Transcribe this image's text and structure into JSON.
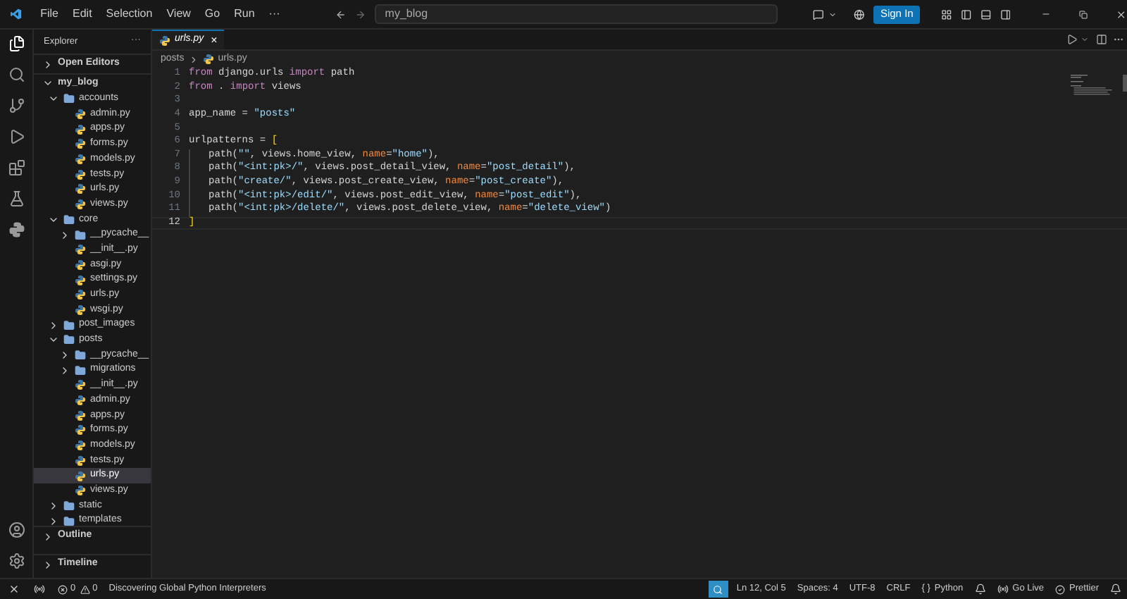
{
  "menu": [
    "File",
    "Edit",
    "Selection",
    "View",
    "Go",
    "Run",
    "···"
  ],
  "command_center": {
    "value": "my_blog"
  },
  "sign_in": "Sign In",
  "explorer": {
    "title": "Explorer",
    "more": "···",
    "sections": [
      {
        "label": "Open Editors",
        "expanded": false
      }
    ]
  },
  "tree": {
    "label": "my_blog",
    "expanded": true,
    "children": [
      {
        "label": "accounts",
        "kind": "folder",
        "expanded": true,
        "children": [
          {
            "label": "admin.py",
            "kind": "python",
            "selected": false
          },
          {
            "label": "apps.py",
            "kind": "python",
            "selected": false
          },
          {
            "label": "forms.py",
            "kind": "python",
            "selected": false
          },
          {
            "label": "models.py",
            "kind": "python",
            "selected": false
          },
          {
            "label": "tests.py",
            "kind": "python",
            "selected": false
          },
          {
            "label": "urls.py",
            "kind": "python",
            "selected": false
          },
          {
            "label": "views.py",
            "kind": "python",
            "selected": false
          }
        ]
      },
      {
        "label": "core",
        "kind": "folder",
        "expanded": true,
        "children": [
          {
            "label": "__pycache__",
            "kind": "folder",
            "expanded": false
          },
          {
            "label": "__init__.py",
            "kind": "python",
            "selected": false
          },
          {
            "label": "asgi.py",
            "kind": "python",
            "selected": false
          },
          {
            "label": "settings.py",
            "kind": "python",
            "selected": false
          },
          {
            "label": "urls.py",
            "kind": "python",
            "selected": false
          },
          {
            "label": "wsgi.py",
            "kind": "python",
            "selected": false
          }
        ]
      },
      {
        "label": "post_images",
        "kind": "folder",
        "expanded": false
      },
      {
        "label": "posts",
        "kind": "folder",
        "expanded": true,
        "children": [
          {
            "label": "__pycache__",
            "kind": "folder",
            "expanded": false
          },
          {
            "label": "migrations",
            "kind": "folder",
            "expanded": false
          },
          {
            "label": "__init__.py",
            "kind": "python",
            "selected": false
          },
          {
            "label": "admin.py",
            "kind": "python",
            "selected": false
          },
          {
            "label": "apps.py",
            "kind": "python",
            "selected": false
          },
          {
            "label": "forms.py",
            "kind": "python",
            "selected": false
          },
          {
            "label": "models.py",
            "kind": "python",
            "selected": false
          },
          {
            "label": "tests.py",
            "kind": "python",
            "selected": false
          },
          {
            "label": "urls.py",
            "kind": "python",
            "selected": true
          },
          {
            "label": "views.py",
            "kind": "python",
            "selected": false
          }
        ]
      },
      {
        "label": "static",
        "kind": "folder",
        "expanded": false
      },
      {
        "label": "templates",
        "kind": "folder",
        "expanded": false
      }
    ]
  },
  "bottom_sections": [
    {
      "label": "Outline",
      "expanded": false
    },
    {
      "label": "Timeline",
      "expanded": false
    }
  ],
  "tab": {
    "label": "urls.py",
    "close": "×",
    "selected": true
  },
  "breadcrumb": [
    "posts",
    "urls.py"
  ],
  "code": {
    "lines": [
      {
        "number": "1",
        "indent": false,
        "tokens": [
          {
            "kind": "keyword",
            "text": "from"
          },
          {
            "kind": "plain",
            "text": " django.urls "
          },
          {
            "kind": "keyword",
            "text": "import"
          },
          {
            "kind": "plain",
            "text": " path"
          }
        ]
      },
      {
        "number": "2",
        "indent": false,
        "tokens": [
          {
            "kind": "keyword",
            "text": "from"
          },
          {
            "kind": "plain",
            "text": " . "
          },
          {
            "kind": "keyword",
            "text": "import"
          },
          {
            "kind": "plain",
            "text": " views"
          }
        ]
      },
      {
        "number": "3",
        "indent": false
      },
      {
        "number": "4",
        "indent": false,
        "tokens": [
          {
            "kind": "plain",
            "text": "app_name = "
          },
          {
            "kind": "string",
            "text": "\"posts\""
          }
        ]
      },
      {
        "number": "5",
        "indent": false
      },
      {
        "number": "6",
        "indent": false,
        "tokens": [
          {
            "kind": "plain",
            "text": "urlpatterns = "
          },
          {
            "kind": "bracket",
            "text": "["
          }
        ]
      },
      {
        "number": "7",
        "indent": true,
        "tokens": [
          {
            "kind": "plain",
            "text": "path("
          },
          {
            "kind": "string",
            "text": "\"\""
          },
          {
            "kind": "plain",
            "text": ", views.home_view, "
          },
          {
            "kind": "param",
            "text": "name"
          },
          {
            "kind": "plain",
            "text": "="
          },
          {
            "kind": "string",
            "text": "\"home\""
          },
          {
            "kind": "plain",
            "text": "),"
          }
        ]
      },
      {
        "number": "8",
        "indent": true,
        "tokens": [
          {
            "kind": "plain",
            "text": "path("
          },
          {
            "kind": "string",
            "text": "\"<int:pk>/\""
          },
          {
            "kind": "plain",
            "text": ", views.post_detail_view, "
          },
          {
            "kind": "param",
            "text": "name"
          },
          {
            "kind": "plain",
            "text": "="
          },
          {
            "kind": "string",
            "text": "\"post_detail\""
          },
          {
            "kind": "plain",
            "text": "),"
          }
        ]
      },
      {
        "number": "9",
        "indent": true,
        "tokens": [
          {
            "kind": "plain",
            "text": "path("
          },
          {
            "kind": "string",
            "text": "\"create/\""
          },
          {
            "kind": "plain",
            "text": ", views.post_create_view, "
          },
          {
            "kind": "param",
            "text": "name"
          },
          {
            "kind": "plain",
            "text": "="
          },
          {
            "kind": "string",
            "text": "\"post_create\""
          },
          {
            "kind": "plain",
            "text": "),"
          }
        ]
      },
      {
        "number": "10",
        "indent": true,
        "tokens": [
          {
            "kind": "plain",
            "text": "path("
          },
          {
            "kind": "string",
            "text": "\"<int:pk>/edit/\""
          },
          {
            "kind": "plain",
            "text": ", views.post_edit_view, "
          },
          {
            "kind": "param",
            "text": "name"
          },
          {
            "kind": "plain",
            "text": "="
          },
          {
            "kind": "string",
            "text": "\"post_edit\""
          },
          {
            "kind": "plain",
            "text": "),"
          }
        ]
      },
      {
        "number": "11",
        "indent": true,
        "tokens": [
          {
            "kind": "plain",
            "text": "path("
          },
          {
            "kind": "string",
            "text": "\"<int:pk>/delete/\""
          },
          {
            "kind": "plain",
            "text": ", views.post_delete_view, "
          },
          {
            "kind": "param",
            "text": "name"
          },
          {
            "kind": "plain",
            "text": "="
          },
          {
            "kind": "string",
            "text": "\"delete_view\""
          },
          {
            "kind": "plain",
            "text": ")"
          }
        ]
      },
      {
        "number": "12",
        "indent": false,
        "current": true,
        "tokens": [
          {
            "kind": "bracket",
            "text": "]"
          }
        ]
      }
    ]
  },
  "status_bar": {
    "errors": "0",
    "warnings": "0",
    "message": "Discovering Global Python Interpreters",
    "position": "Ln 12, Col 5",
    "spaces": "Spaces: 4",
    "encoding": "UTF-8",
    "eol": "CRLF",
    "language_braces": "{ }",
    "language": "Python",
    "go_live": "Go Live",
    "prettier": "Prettier"
  }
}
